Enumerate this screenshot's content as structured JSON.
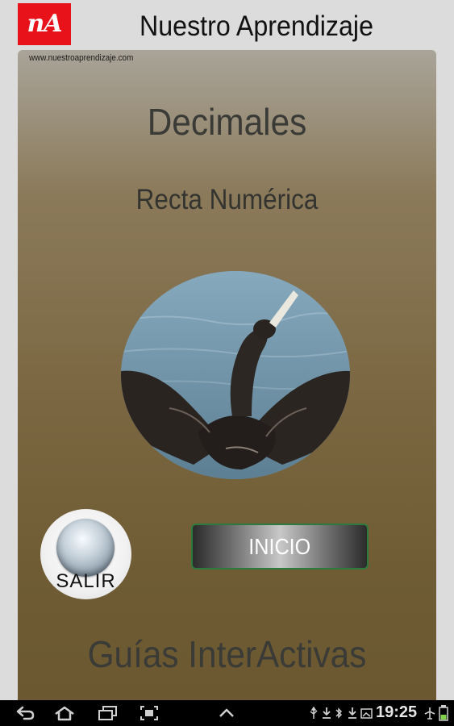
{
  "header": {
    "logo_text": "nA",
    "title": "Nuestro Aprendizaje"
  },
  "panel": {
    "website": "www.nuestroaprendizaje.com",
    "topic": "Decimales",
    "subtopic": "Recta Numérica",
    "photo_icon": "bird-photo",
    "exit_label": "SALIR",
    "start_label": "INICIO",
    "footer_brand": "Guías InterActivas"
  },
  "system_bar": {
    "time": "19:25",
    "icons": [
      "back-icon",
      "home-icon",
      "recent-apps-icon",
      "screenshot-icon",
      "up-arrow-icon",
      "usb-icon",
      "download-icon",
      "sync-icon",
      "download-icon",
      "battery-icon"
    ]
  },
  "colors": {
    "logo_red": "#e8121b",
    "start_border_green": "#2d7a3d"
  }
}
